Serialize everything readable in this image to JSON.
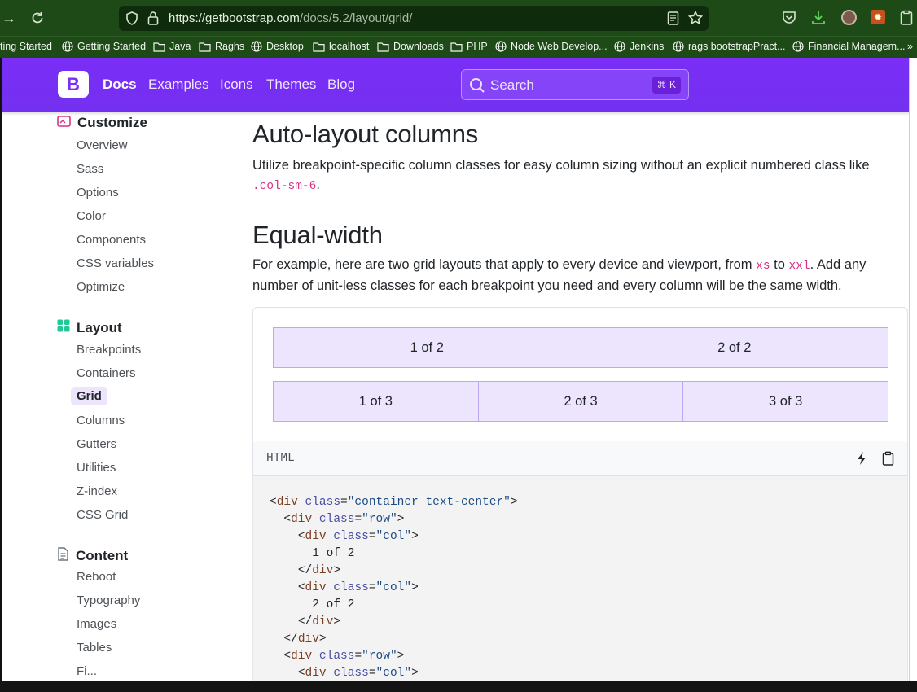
{
  "browser": {
    "url_host": "https://getbootstrap.com",
    "url_path": "/docs/5.2/layout/grid/",
    "bookmarks": [
      {
        "label": "ting Started",
        "icon": "none"
      },
      {
        "label": "Getting Started",
        "icon": "globe-icon"
      },
      {
        "label": "Java",
        "icon": "folder-icon"
      },
      {
        "label": "Raghs",
        "icon": "folder-icon"
      },
      {
        "label": "Desktop",
        "icon": "globe-icon"
      },
      {
        "label": "localhost",
        "icon": "folder-icon"
      },
      {
        "label": "Downloads",
        "icon": "folder-icon"
      },
      {
        "label": "PHP",
        "icon": "folder-icon"
      },
      {
        "label": "Node Web Develop...",
        "icon": "globe-icon"
      },
      {
        "label": "Jenkins",
        "icon": "globe-icon"
      },
      {
        "label": "rags bootstrapPract...",
        "icon": "globe-icon"
      },
      {
        "label": "Financial Managem...",
        "icon": "globe-icon"
      }
    ]
  },
  "nav": {
    "brand": "B",
    "links": [
      "Docs",
      "Examples",
      "Icons",
      "Themes",
      "Blog"
    ],
    "search_placeholder": "Search",
    "search_shortcut": "⌘ K"
  },
  "sidebar": {
    "customize": {
      "title": "Customize",
      "items": [
        "Overview",
        "Sass",
        "Options",
        "Color",
        "Components",
        "CSS variables",
        "Optimize"
      ]
    },
    "layout": {
      "title": "Layout",
      "items": [
        "Breakpoints",
        "Containers",
        "Grid",
        "Columns",
        "Gutters",
        "Utilities",
        "Z-index",
        "CSS Grid"
      ],
      "active": "Grid"
    },
    "content": {
      "title": "Content",
      "items": [
        "Reboot",
        "Typography",
        "Images",
        "Tables",
        "Fi..."
      ]
    }
  },
  "main": {
    "h_auto": "Auto-layout columns",
    "auto_text": "Utilize breakpoint-specific column classes for easy column sizing without an explicit numbered class like",
    "auto_code": ".col-sm-6",
    "h_equal": "Equal-width",
    "equal_text_1": "For example, here are two grid layouts that apply to every device and viewport, from",
    "equal_code_xs": "xs",
    "equal_text_2": "to",
    "equal_code_xxl": "xxl",
    "equal_text_3": ". Add any number of unit-less classes for each breakpoint you need and every column will be the same width.",
    "row1": [
      "1 of 2",
      "2 of 2"
    ],
    "row2": [
      "1 of 3",
      "2 of 3",
      "3 of 3"
    ],
    "code_lang": "HTML",
    "code": {
      "l1_tag": "div",
      "l1_attr": "class",
      "l1_val": "\"container text-center\"",
      "l2_tag": "div",
      "l2_attr": "class",
      "l2_val": "\"row\"",
      "l3_tag": "div",
      "l3_attr": "class",
      "l3_val": "\"col\"",
      "l4_text": "1 of 2",
      "l5_tag": "div",
      "l6_tag": "div",
      "l6_attr": "class",
      "l6_val": "\"col\"",
      "l7_text": "2 of 2",
      "l8_tag": "div",
      "l9_tag": "div",
      "l10_tag": "div",
      "l10_attr": "class",
      "l10_val": "\"row\"",
      "l11_tag": "div",
      "l11_attr": "class",
      "l11_val": "\"col\""
    }
  },
  "colors": {
    "chrome": "#1d4a16",
    "bootstrap_purple": "#7a2ef6",
    "col_fill": "#ece5fd",
    "code_pink": "#d63384"
  }
}
